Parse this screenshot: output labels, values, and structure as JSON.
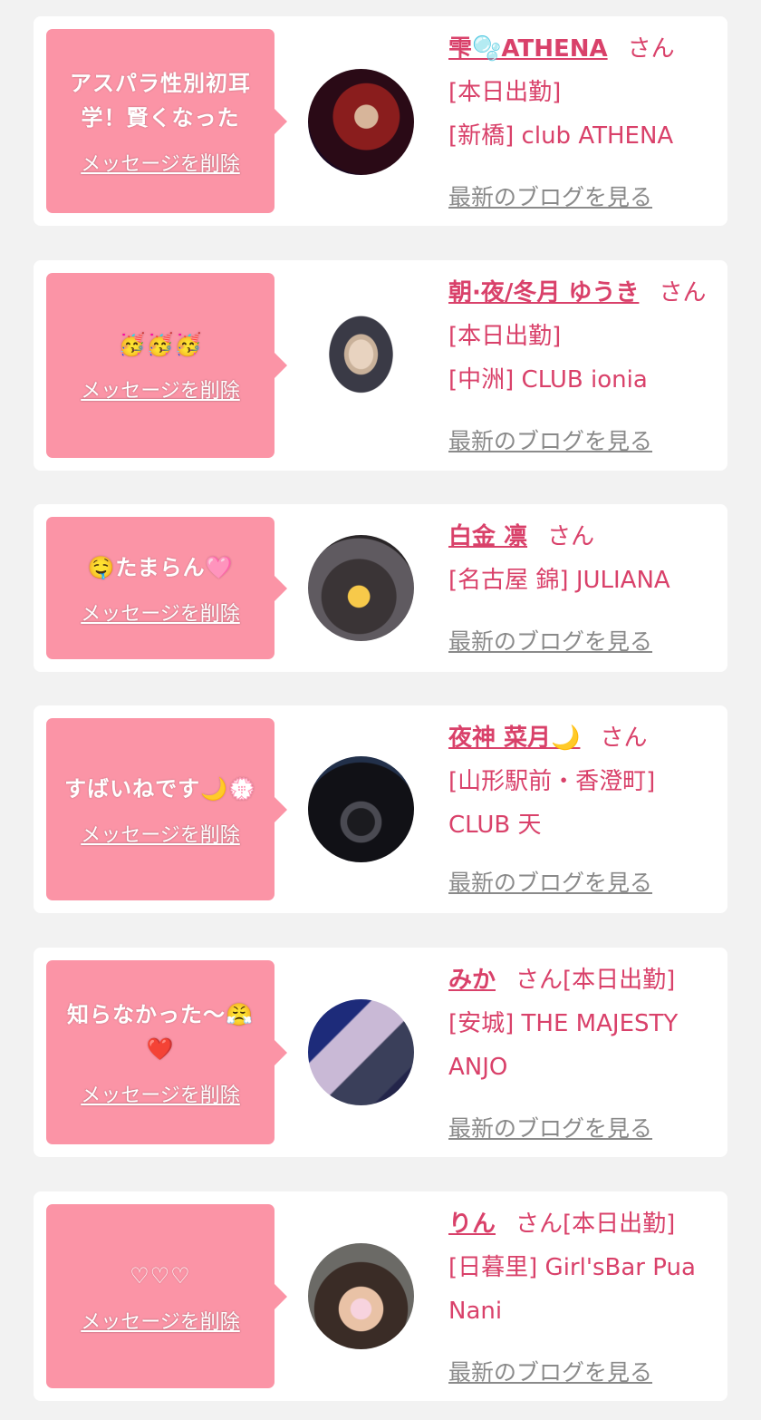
{
  "delete_label": "メッセージを削除",
  "blog_label": "最新のブログを見る",
  "cards": [
    {
      "message": "アスパラ性別初耳学！賢くなった",
      "name": "雫🫧ATHENA",
      "honorific": "さん",
      "info_lines": [
        "[本日出勤]",
        "[新橋] club ATHENA"
      ]
    },
    {
      "message": "🥳🥳🥳",
      "name": "朝·夜/冬月 ゆうき",
      "honorific": "さん[本日出勤]",
      "info_lines": [
        "[中洲] CLUB ionia"
      ]
    },
    {
      "message": "🤤たまらん🩷",
      "name": "白金 凛",
      "honorific": "さん",
      "info_lines": [
        "[名古屋 錦] JULIANA"
      ]
    },
    {
      "message": "すばいねです🌙💮",
      "name": "夜神 菜月🌙",
      "honorific": "さん",
      "info_lines": [
        "[山形駅前・香澄町] CLUB 天"
      ]
    },
    {
      "message": "知らなかった〜😤❤️",
      "name": "みか",
      "honorific": "さん[本日出勤]",
      "info_lines": [
        "[安城] THE MAJESTY ANJO"
      ]
    },
    {
      "message": "♡♡♡",
      "name": "りん",
      "honorific": "さん[本日出勤]",
      "info_lines": [
        "[日暮里] Girl'sBar Pua Nani"
      ]
    }
  ],
  "colors": {
    "bubble": "#fb94a6",
    "accent": "#d9416a",
    "link_gray": "#8a8a8a",
    "background": "#f2f2f2"
  },
  "icons": [
    "profile-photo",
    "profile-photo",
    "profile-photo",
    "profile-photo",
    "profile-photo",
    "profile-photo"
  ]
}
